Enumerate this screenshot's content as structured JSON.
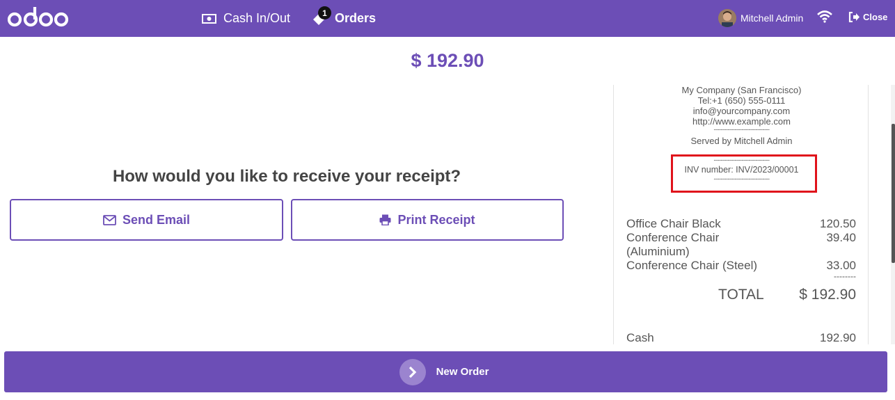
{
  "topbar": {
    "logo_text": "odoo",
    "nav": [
      {
        "label": "Cash In/Out",
        "icon": "cash-icon"
      },
      {
        "label": "Orders",
        "icon": "tag-icon",
        "badge": "1"
      }
    ],
    "user_name": "Mitchell Admin",
    "close_label": "Close",
    "accent": "#6c4eb6"
  },
  "main": {
    "amount": "$ 192.90",
    "question": "How would you like to receive your receipt?",
    "send_email_label": "Send Email",
    "print_receipt_label": "Print Receipt"
  },
  "receipt": {
    "company": "My Company (San Francisco)",
    "tel": "Tel:+1 (650) 555-0111",
    "email": "info@yourcompany.com",
    "website": "http://www.example.com",
    "dash": "--------------------------------",
    "served_by": "Served by Mitchell Admin",
    "inv_number": "INV number: INV/2023/00001",
    "lines": [
      {
        "name": "Office Chair Black",
        "price": "120.50"
      },
      {
        "name": "Conference Chair (Aluminium)",
        "price": "39.40"
      },
      {
        "name": "Conference Chair (Steel)",
        "price": "33.00"
      }
    ],
    "lines_dash": "--------",
    "total_label": "TOTAL",
    "total_value": "$ 192.90",
    "payment_label": "Cash",
    "payment_value": "192.90",
    "highlight_color": "#e0121b"
  },
  "footer": {
    "new_order_label": "New Order"
  }
}
